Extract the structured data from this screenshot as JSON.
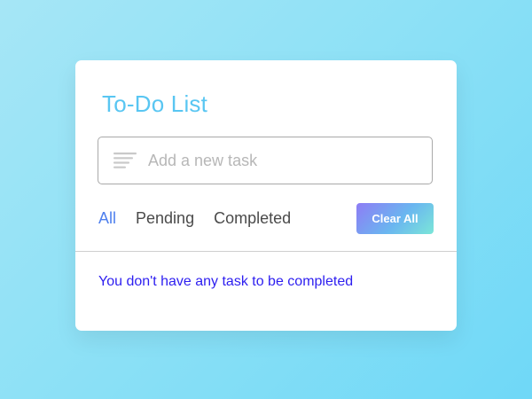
{
  "todo": {
    "title": "To-Do List",
    "input": {
      "placeholder": "Add a new task",
      "value": ""
    },
    "filters": [
      {
        "label": "All",
        "active": true
      },
      {
        "label": "Pending",
        "active": false
      },
      {
        "label": "Completed",
        "active": false
      }
    ],
    "clear_all_label": "Clear All",
    "empty_message": "You don't have any task to be completed"
  },
  "colors": {
    "title": "#59c6f2",
    "active_filter": "#4f80ee",
    "empty_message": "#2d1ef0",
    "clear_button_gradient": [
      "#8e7cf5",
      "#7be6d8"
    ]
  },
  "icons": {
    "input_icon": "menu-lines-icon"
  }
}
